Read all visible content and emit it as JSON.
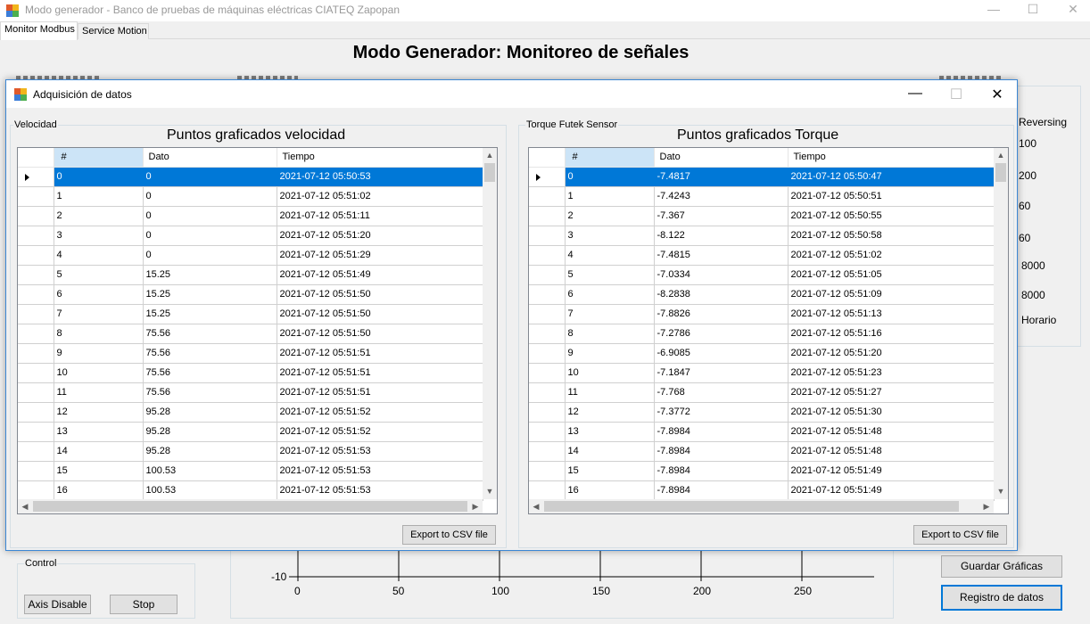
{
  "window": {
    "title": "Modo generador - Banco de pruebas de máquinas eléctricas CIATEQ Zapopan",
    "minimize": "—",
    "maximize": "☐",
    "close": "✕"
  },
  "tabs": [
    {
      "label": "Monitor Modbus"
    },
    {
      "label": "Service Motion"
    }
  ],
  "main": {
    "title": "Modo Generador: Monitoreo de señales",
    "right_panel": {
      "reversing_label": "Reversing",
      "values": [
        "100",
        "200",
        "60",
        "60",
        "8000",
        "8000",
        "Horario"
      ]
    },
    "control_group": {
      "label": "Control",
      "axis_disable": "Axis Disable",
      "stop": "Stop"
    },
    "chart": {
      "y_tick": "-10",
      "x_ticks": [
        "0",
        "50",
        "100",
        "150",
        "200",
        "250"
      ]
    },
    "buttons": {
      "guardar": "Guardar Gráficas",
      "registro": "Registro de datos"
    }
  },
  "dialog": {
    "title": "Adquisición de datos",
    "minimize": "—",
    "maximize": "☐",
    "close": "✕",
    "velocidad": {
      "group_label": "Velocidad",
      "title": "Puntos graficados velocidad",
      "columns": [
        "#",
        "Dato",
        "Tiempo"
      ],
      "rows": [
        [
          "0",
          "0",
          "2021-07-12 05:50:53"
        ],
        [
          "1",
          "0",
          "2021-07-12 05:51:02"
        ],
        [
          "2",
          "0",
          "2021-07-12 05:51:11"
        ],
        [
          "3",
          "0",
          "2021-07-12 05:51:20"
        ],
        [
          "4",
          "0",
          "2021-07-12 05:51:29"
        ],
        [
          "5",
          "15.25",
          "2021-07-12 05:51:49"
        ],
        [
          "6",
          "15.25",
          "2021-07-12 05:51:50"
        ],
        [
          "7",
          "15.25",
          "2021-07-12 05:51:50"
        ],
        [
          "8",
          "75.56",
          "2021-07-12 05:51:50"
        ],
        [
          "9",
          "75.56",
          "2021-07-12 05:51:51"
        ],
        [
          "10",
          "75.56",
          "2021-07-12 05:51:51"
        ],
        [
          "11",
          "75.56",
          "2021-07-12 05:51:51"
        ],
        [
          "12",
          "95.28",
          "2021-07-12 05:51:52"
        ],
        [
          "13",
          "95.28",
          "2021-07-12 05:51:52"
        ],
        [
          "14",
          "95.28",
          "2021-07-12 05:51:53"
        ],
        [
          "15",
          "100.53",
          "2021-07-12 05:51:53"
        ],
        [
          "16",
          "100.53",
          "2021-07-12 05:51:53"
        ]
      ],
      "export": "Export to CSV file"
    },
    "torque": {
      "group_label": "Torque Futek Sensor",
      "title": "Puntos graficados Torque",
      "columns": [
        "#",
        "Dato",
        "Tiempo"
      ],
      "rows": [
        [
          "0",
          "-7.4817",
          "2021-07-12 05:50:47"
        ],
        [
          "1",
          "-7.4243",
          "2021-07-12 05:50:51"
        ],
        [
          "2",
          "-7.367",
          "2021-07-12 05:50:55"
        ],
        [
          "3",
          "-8.122",
          "2021-07-12 05:50:58"
        ],
        [
          "4",
          "-7.4815",
          "2021-07-12 05:51:02"
        ],
        [
          "5",
          "-7.0334",
          "2021-07-12 05:51:05"
        ],
        [
          "6",
          "-8.2838",
          "2021-07-12 05:51:09"
        ],
        [
          "7",
          "-7.8826",
          "2021-07-12 05:51:13"
        ],
        [
          "8",
          "-7.2786",
          "2021-07-12 05:51:16"
        ],
        [
          "9",
          "-6.9085",
          "2021-07-12 05:51:20"
        ],
        [
          "10",
          "-7.1847",
          "2021-07-12 05:51:23"
        ],
        [
          "11",
          "-7.768",
          "2021-07-12 05:51:27"
        ],
        [
          "12",
          "-7.3772",
          "2021-07-12 05:51:30"
        ],
        [
          "13",
          "-7.8984",
          "2021-07-12 05:51:48"
        ],
        [
          "14",
          "-7.8984",
          "2021-07-12 05:51:48"
        ],
        [
          "15",
          "-7.8984",
          "2021-07-12 05:51:49"
        ],
        [
          "16",
          "-7.8984",
          "2021-07-12 05:51:49"
        ]
      ],
      "export": "Export to CSV file"
    }
  }
}
